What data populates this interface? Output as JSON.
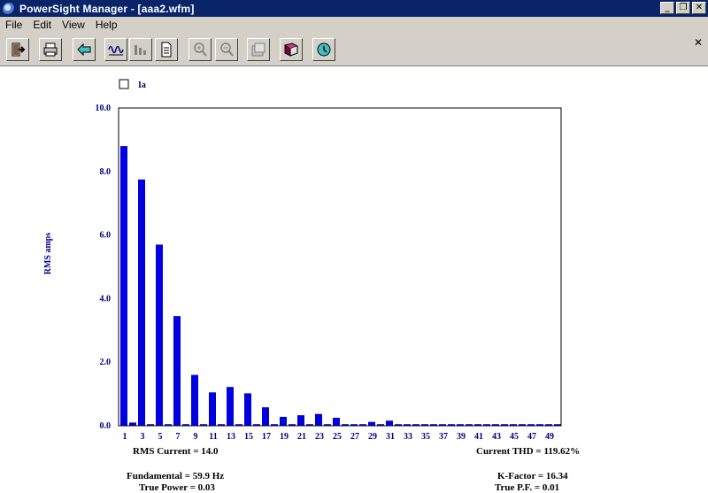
{
  "window": {
    "title": "PowerSight Manager - [aaa2.wfm]"
  },
  "menu": [
    "File",
    "Edit",
    "View",
    "Help"
  ],
  "legend": {
    "label": "Ia"
  },
  "chart_data": {
    "type": "bar",
    "ylabel": "RMS amps",
    "ylim": [
      0,
      10
    ],
    "yticks": [
      "0.0",
      "2.0",
      "4.0",
      "6.0",
      "8.0",
      "10.0"
    ],
    "series": [
      {
        "name": "Ia",
        "x": [
          1,
          2,
          3,
          4,
          5,
          6,
          7,
          8,
          9,
          10,
          11,
          12,
          13,
          14,
          15,
          16,
          17,
          18,
          19,
          20,
          21,
          22,
          23,
          24,
          25,
          26,
          27,
          28,
          29,
          30,
          31,
          32,
          33,
          34,
          35,
          36,
          37,
          38,
          39,
          40,
          41,
          42,
          43,
          44,
          45,
          46,
          47,
          48,
          49,
          50
        ],
        "values": [
          8.8,
          0.1,
          7.75,
          0.05,
          5.7,
          0.05,
          3.45,
          0.05,
          1.6,
          0.05,
          1.05,
          0.05,
          1.22,
          0.05,
          1.02,
          0.05,
          0.58,
          0.05,
          0.28,
          0.05,
          0.33,
          0.05,
          0.37,
          0.05,
          0.25,
          0.05,
          0.05,
          0.05,
          0.12,
          0.05,
          0.16,
          0.05,
          0.05,
          0.05,
          0.05,
          0.05,
          0.05,
          0.05,
          0.05,
          0.05,
          0.05,
          0.05,
          0.05,
          0.05,
          0.05,
          0.05,
          0.05,
          0.05,
          0.05,
          0.05
        ],
        "color": "#0000e0"
      }
    ],
    "xticklabels": [
      "1",
      "3",
      "5",
      "7",
      "9",
      "11",
      "13",
      "15",
      "17",
      "19",
      "21",
      "23",
      "25",
      "27",
      "29",
      "31",
      "33",
      "35",
      "37",
      "39",
      "41",
      "43",
      "45",
      "47",
      "49"
    ]
  },
  "stats": {
    "rms_current": "RMS Current = 14.0",
    "thd": "Current THD = 119.62%",
    "fundamental": "Fundamental = 59.9 Hz",
    "k_factor": "K-Factor = 16.34",
    "true_power": "True Power = 0.03",
    "true_pf": "True P.F. = 0.01"
  },
  "colors": {
    "titlebar": "#0a246a",
    "bar": "#0000e0",
    "axis_text": "#000080"
  }
}
